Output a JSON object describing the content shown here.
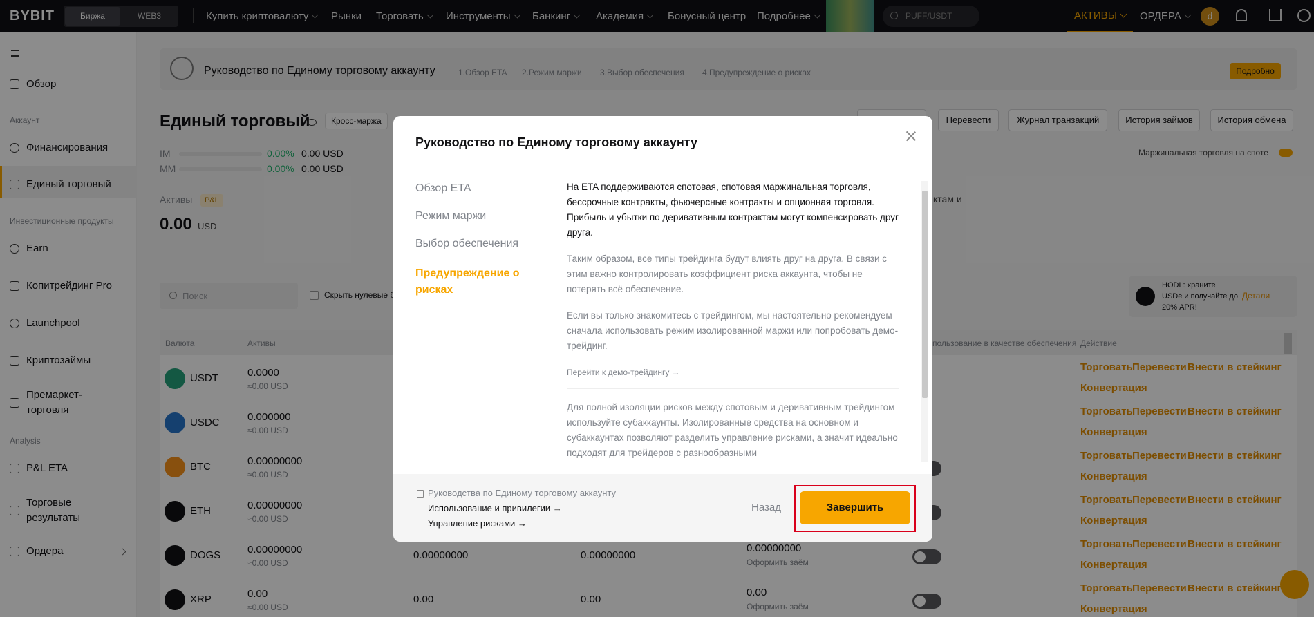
{
  "topnav": {
    "logo": "BYBIT",
    "exchange_tab": "Биржа",
    "web3_tab": "WEB3",
    "buy_crypto": "Купить криптовалюту",
    "markets": "Рынки",
    "trade": "Торговать",
    "tools": "Инструменты",
    "banking": "Банкинг",
    "academy": "Академия",
    "bonus": "Бонусный центр",
    "more": "Подробнее",
    "search_placeholder": "PUFF/USDT",
    "assets": "АКТИВЫ",
    "orders": "ОРДЕРА",
    "avatar_letter": "d"
  },
  "sidebar": {
    "overview": "Обзор",
    "section_account": "Аккаунт",
    "funding": "Финансирования",
    "unified": "Единый торговый",
    "section_invest": "Инвестиционные продукты",
    "earn": "Earn",
    "copytrading": "Копитрейдинг Pro",
    "launchpool": "Launchpool",
    "loans": "Криптозаймы",
    "premarket": "Премаркет-торговля",
    "section_analysis": "Analysis",
    "pnl": "P&L ETA",
    "results": "Торговые результаты",
    "orders": "Ордера"
  },
  "banner": {
    "title": "Руководство по Единому торговому аккаунту",
    "step1": "1.Обзор ETA",
    "step2": "2.Режим маржи",
    "step3": "3.Выбор обеспечения",
    "step4": "4.Предупреждение о рисках",
    "more_button": "Подробно"
  },
  "account": {
    "title": "Единый торговый",
    "margin_mode": "Кросс-маржа",
    "transfer": "Перевести",
    "tx_log": "Журнал транзакций",
    "loan_history": "История займов",
    "exchange_history": "История обмена",
    "im_label": "IM",
    "im_pct": "0.00%",
    "im_val": "0.00 USD",
    "mm_label": "MM",
    "mm_pct": "0.00%",
    "mm_val": "0.00 USD",
    "spot_margin": "Маржинальная торговля на споте",
    "assets_label": "Активы",
    "pnl_badge": "P&L",
    "total": "0.00",
    "total_unit": "USD",
    "bg_text": "ктам и"
  },
  "filters": {
    "search_placeholder": "Поиск",
    "hide_zero": "Скрыть нулевые б"
  },
  "promo": {
    "text": "HODL: храните USDe и получайте до 20% APR!",
    "link": "Детали"
  },
  "table": {
    "col_currency": "Валюта",
    "col_assets": "Активы",
    "col_collateral": "пользование в качестве обеспечения",
    "col_action": "Действие",
    "rows": [
      {
        "coin": "USDT",
        "amount": "0.0000",
        "usd": "≈0.00 USD",
        "c3": "",
        "c4": "",
        "c5": "",
        "c5sub": ""
      },
      {
        "coin": "USDC",
        "amount": "0.000000",
        "usd": "≈0.00 USD",
        "c3": "",
        "c4": "",
        "c5": "",
        "c5sub": ""
      },
      {
        "coin": "BTC",
        "amount": "0.00000000",
        "usd": "≈0.00 USD",
        "c3": "",
        "c4": "",
        "c5": "",
        "c5sub": ""
      },
      {
        "coin": "ETH",
        "amount": "0.00000000",
        "usd": "≈0.00 USD",
        "c3": "",
        "c4": "",
        "c5": "",
        "c5sub": ""
      },
      {
        "coin": "DOGS",
        "amount": "0.00000000",
        "usd": "≈0.00 USD",
        "c3": "0.00000000",
        "c4": "0.00000000",
        "c5": "0.00000000",
        "c5sub": "Оформить заём"
      },
      {
        "coin": "XRP",
        "amount": "0.00",
        "usd": "≈0.00 USD",
        "c3": "0.00",
        "c4": "0.00",
        "c5": "0.00",
        "c5sub": "Оформить заём"
      }
    ],
    "act_trade": "Торговать",
    "act_transfer": "Перевести",
    "act_stake": "Внести в стейкинг",
    "act_convert": "Конвертация"
  },
  "modal": {
    "title": "Руководство по Единому торговому аккаунту",
    "nav": [
      "Обзор ETA",
      "Режим маржи",
      "Выбор обеспечения",
      "Предупреждение о рисках"
    ],
    "p1": "На ETA поддерживаются спотовая, спотовая маржинальная торговля, бессрочные контракты, фьючерсные контракты и опционная торговля. Прибыль и убытки по деривативным контрактам могут компенсировать друг друга.",
    "p2": "Таким образом, все типы трейдинга будут влиять друг на друга. В связи с этим важно контролировать коэффициент риска аккаунта, чтобы не потерять всё обеспечение.",
    "p3": "Если вы только знакомитесь с трейдингом, мы настоятельно рекомендуем сначала использовать режим изолированной маржи или попробовать демо-трейдинг.",
    "demo_link": "Перейти к демо-трейдингу",
    "p4": "Для полной изоляции рисков между спотовым и деривативным трейдингом используйте субаккаунты. Изолированные средства на основном и субаккаунтах позволяют разделить управление рисками, а значит идеально подходят для трейдеров с разнообразными",
    "footer_guide": "Руководства по Единому торговому аккаунту",
    "footer_link1": "Использование и привилегии",
    "footer_link2": "Управление рисками",
    "back": "Назад",
    "finish": "Завершить"
  }
}
